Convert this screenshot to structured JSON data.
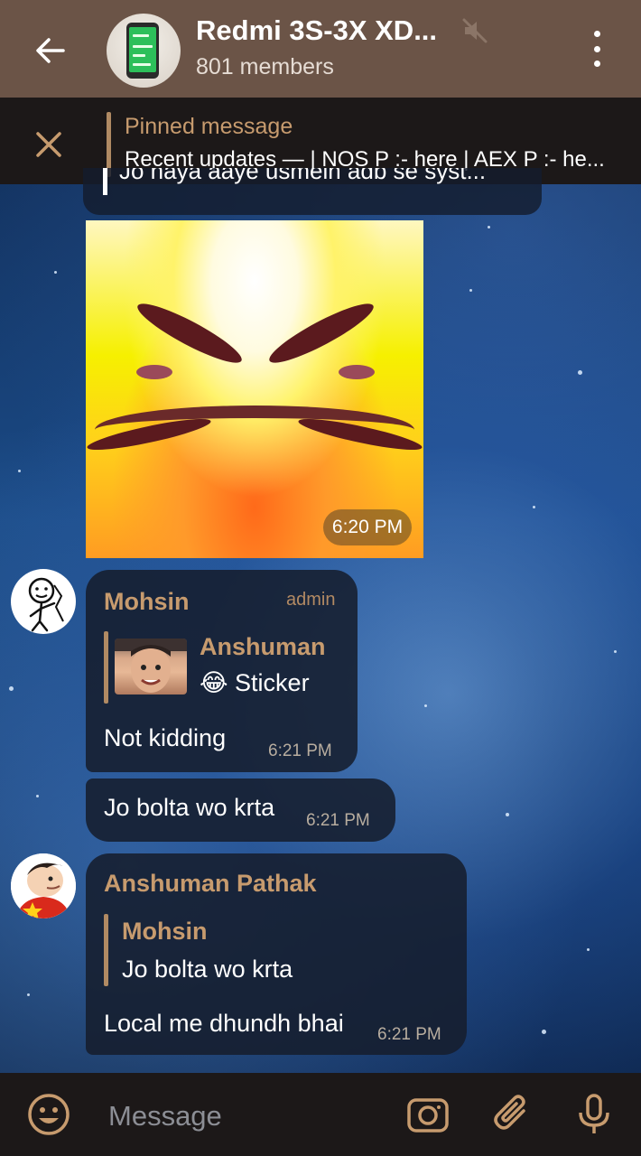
{
  "header": {
    "title": "Redmi 3S-3X XD...",
    "subtitle": "801 members"
  },
  "pinned": {
    "label": "Pinned message",
    "text": "Recent updates —  | NOS P :- here | AEX P :- he..."
  },
  "partial_message": {
    "text": "Jo naya aaye usmein adb se syst..."
  },
  "sticker": {
    "time": "6:20 PM"
  },
  "messages": [
    {
      "sender": "Mohsin",
      "role": "admin",
      "reply": {
        "name": "Anshuman",
        "text": "😂 Sticker"
      },
      "text": "Not kidding",
      "time": "6:21 PM"
    },
    {
      "text": "Jo bolta wo krta",
      "time": "6:21 PM"
    },
    {
      "sender": "Anshuman Pathak",
      "reply": {
        "name": "Mohsin",
        "text": "Jo bolta wo krta"
      },
      "text": "Local me dhundh bhai",
      "time": "6:21 PM"
    }
  ],
  "input": {
    "placeholder": "Message"
  },
  "colors": {
    "header_bg": "#6b5447",
    "accent": "#c79b6e",
    "bar_bg": "#1c1818"
  }
}
